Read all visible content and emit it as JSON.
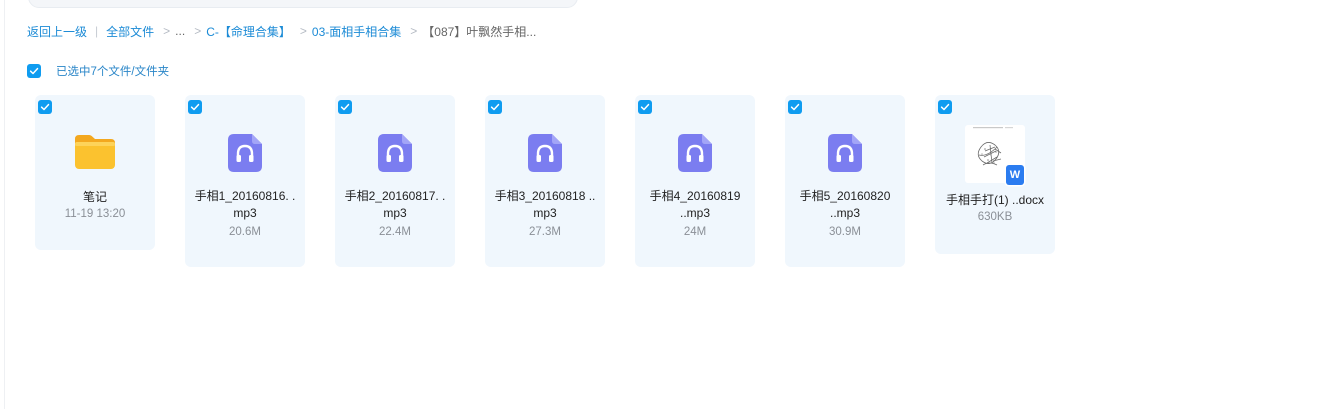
{
  "breadcrumb": {
    "back": "返回上一级",
    "divider": "|",
    "all_files": "全部文件",
    "ellipsis": "...",
    "level1": "C-【命理合集】",
    "level2": "03-面相手相合集",
    "current": "【087】叶飘然手相...",
    "sep": ">"
  },
  "selection": {
    "text": "已选中7个文件/文件夹",
    "checked": true
  },
  "files": [
    {
      "type": "folder",
      "name": "笔记",
      "meta": "11-19 13:20",
      "checked": true,
      "icon": "folder-icon"
    },
    {
      "type": "audio",
      "name1": "手相1_20160816. .",
      "name2": "mp3",
      "meta": "20.6M",
      "checked": true,
      "icon": "audio-file-icon"
    },
    {
      "type": "audio",
      "name1": "手相2_20160817. .",
      "name2": "mp3",
      "meta": "22.4M",
      "checked": true,
      "icon": "audio-file-icon"
    },
    {
      "type": "audio",
      "name1": "手相3_20160818 ..",
      "name2": "mp3",
      "meta": "27.3M",
      "checked": true,
      "icon": "audio-file-icon"
    },
    {
      "type": "audio",
      "name1": "手相4_20160819",
      "name2": "..mp3",
      "meta": "24M",
      "checked": true,
      "icon": "audio-file-icon"
    },
    {
      "type": "audio",
      "name1": "手相5_20160820",
      "name2": "..mp3",
      "meta": "30.9M",
      "checked": true,
      "icon": "audio-file-icon"
    },
    {
      "type": "doc",
      "name": "手相手打(1) ..docx",
      "meta": "630KB",
      "checked": true,
      "icon": "word-doc-icon",
      "badge": "W"
    }
  ],
  "colors": {
    "accent": "#0f9cf0",
    "link": "#1c8bd6",
    "card_bg": "#f0f7fd",
    "audio_icon": "#7b7df0",
    "folder": "#f7b82a"
  }
}
